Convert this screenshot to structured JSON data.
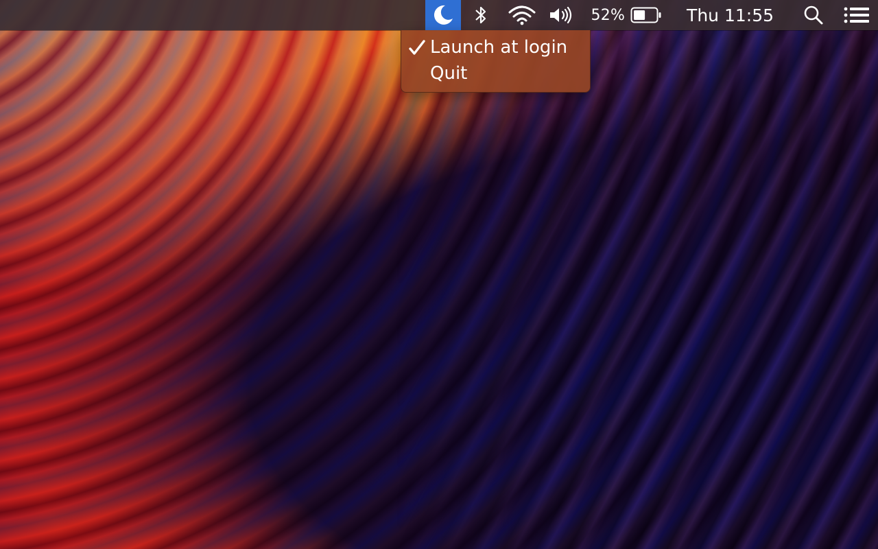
{
  "menubar": {
    "app_icon": "moon-bluetooth-icon",
    "bluetooth_icon": "bluetooth-icon",
    "wifi_icon": "wifi-icon",
    "volume_icon": "volume-icon",
    "battery": {
      "percent_label": "52%",
      "level": 0.52,
      "icon": "battery-icon"
    },
    "clock": "Thu 11:55",
    "search_icon": "search-icon",
    "notification_icon": "notification-center-icon",
    "highlight_color": "#2f6fd3"
  },
  "dropdown": {
    "items": [
      {
        "label": "Launch at login",
        "checked": true
      },
      {
        "label": "Quit",
        "checked": false
      }
    ]
  }
}
